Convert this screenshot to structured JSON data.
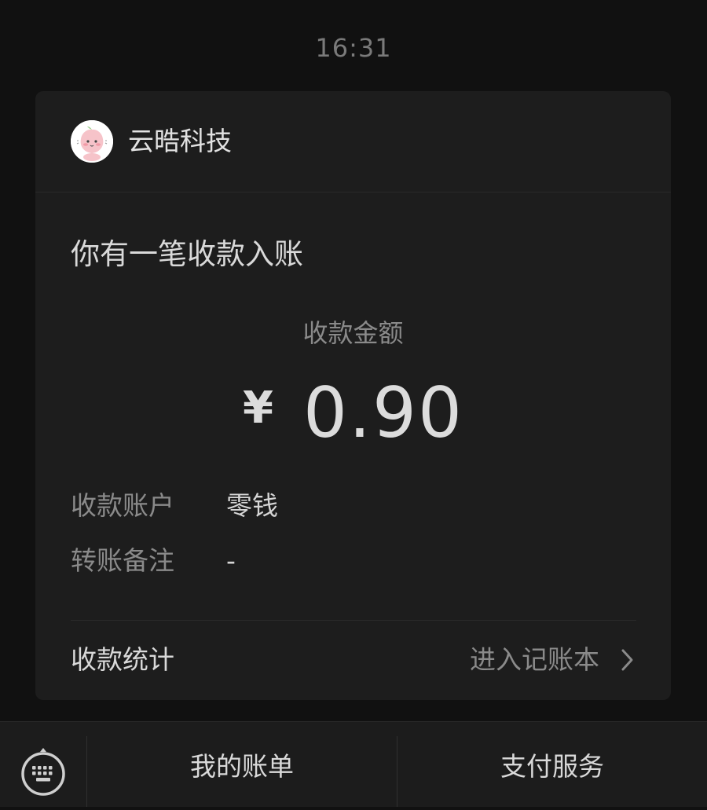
{
  "status": {
    "time": "16:31"
  },
  "merchant": {
    "name": "云晧科技",
    "avatar_icon": "peach-character-avatar"
  },
  "notice": {
    "headline": "你有一笔收款入账",
    "amount_label": "收款金额",
    "currency_symbol": "¥",
    "amount": "0.90",
    "details": [
      {
        "key": "收款账户",
        "value": "零钱"
      },
      {
        "key": "转账备注",
        "value": "-"
      }
    ],
    "stats_label": "收款统计",
    "ledger_link": "进入记账本"
  },
  "bottom_menu": {
    "keyboard_icon": "keyboard-icon",
    "items": [
      {
        "label": "我的账单"
      },
      {
        "label": "支付服务"
      }
    ]
  },
  "colors": {
    "background": "#111111",
    "card": "#1d1d1d",
    "primary_text": "#d9d9d9",
    "secondary_text": "#8a8a8a"
  }
}
